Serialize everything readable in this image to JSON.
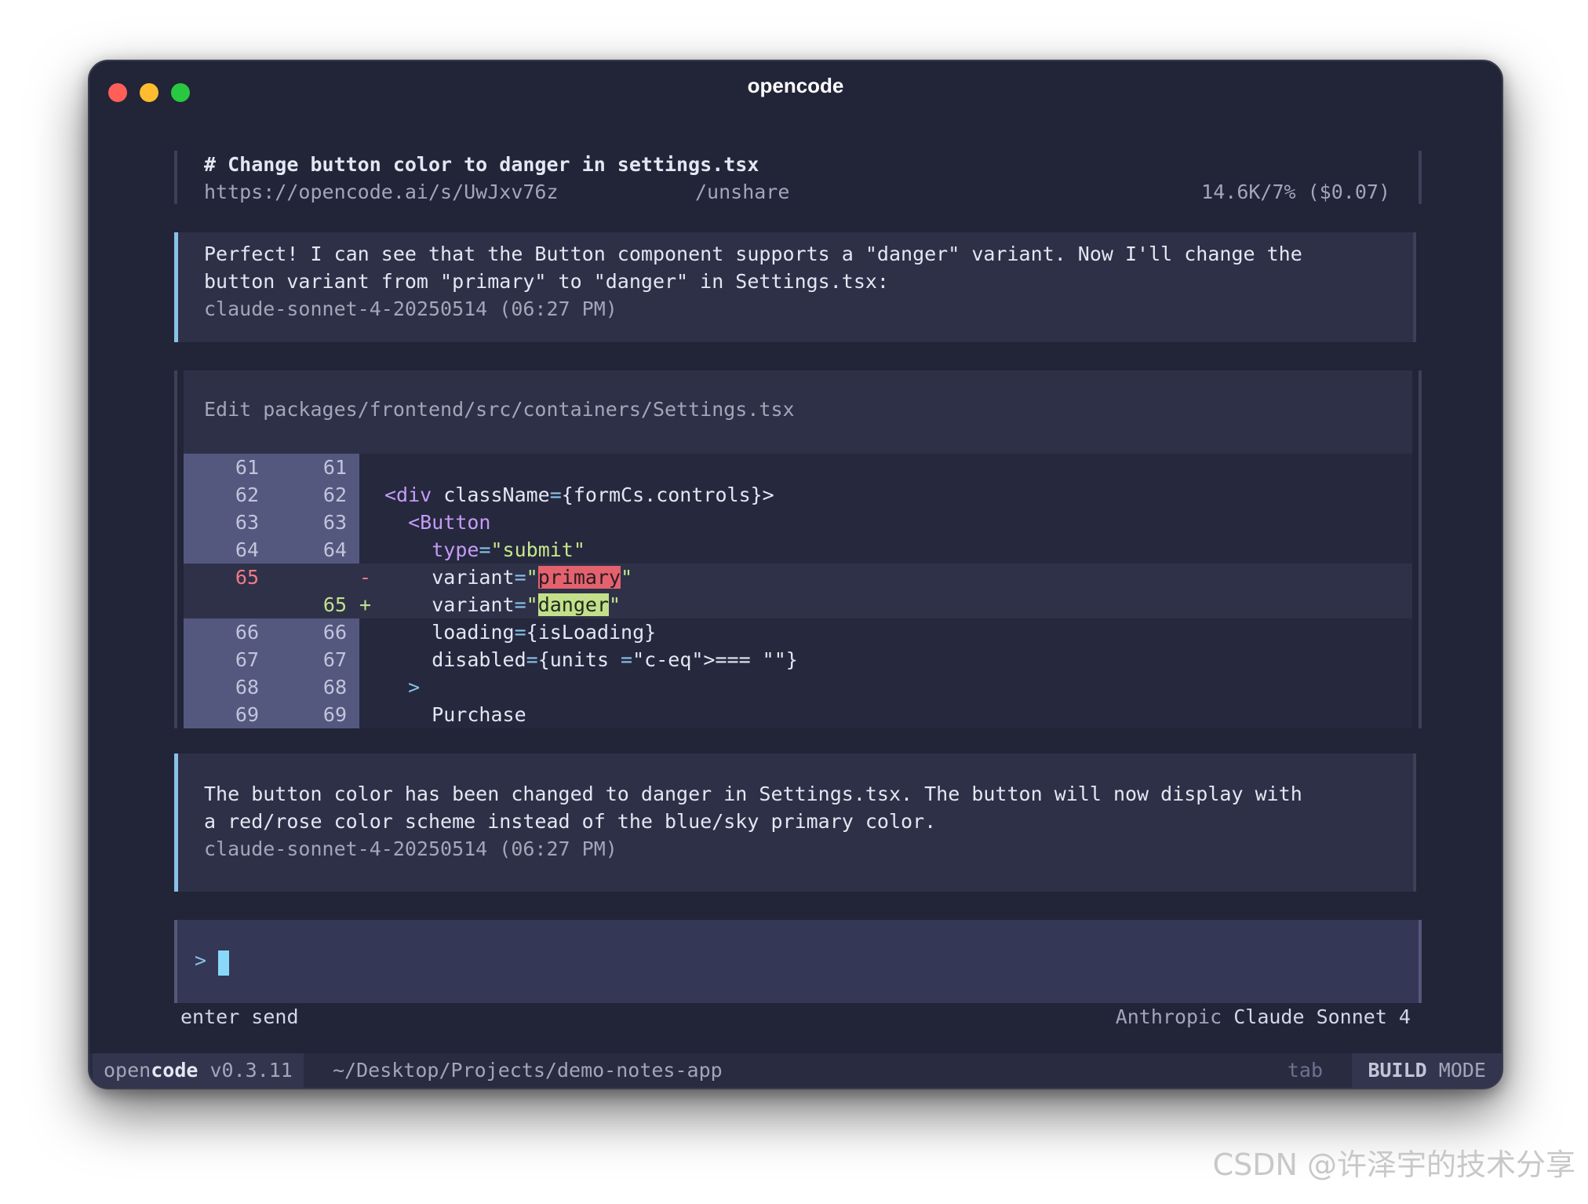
{
  "window": {
    "title": "opencode"
  },
  "header": {
    "title": "# Change button color to danger in settings.tsx",
    "share_link": "https://opencode.ai/s/UwJxv76z",
    "unshare": "/unshare",
    "usage": "14.6K/7% ($0.07)"
  },
  "messages": [
    {
      "lines": [
        "Perfect! I can see that the Button component supports a \"danger\" variant. Now I'll change the",
        "button variant from \"primary\" to \"danger\" in Settings.tsx:"
      ],
      "meta": "claude-sonnet-4-20250514 (06:27 PM)"
    },
    {
      "lines": [
        "The button color has been changed to danger in Settings.tsx. The button will now display with",
        "a red/rose color scheme instead of the blue/sky primary color."
      ],
      "meta": "claude-sonnet-4-20250514 (06:27 PM)"
    }
  ],
  "tool": {
    "header": "Edit packages/frontend/src/containers/Settings.tsx",
    "diff": [
      {
        "old": "61",
        "new": "61",
        "type": "context",
        "code": ""
      },
      {
        "old": "62",
        "new": "62",
        "type": "context",
        "code": "<div className={formCs.controls}>"
      },
      {
        "old": "63",
        "new": "63",
        "type": "context",
        "code": "  <Button"
      },
      {
        "old": "64",
        "new": "64",
        "type": "context",
        "code": "    type=\"submit\""
      },
      {
        "old": "65",
        "new": "",
        "type": "removed",
        "sign": "-",
        "code": "    variant=\"primary\""
      },
      {
        "old": "",
        "new": "65",
        "type": "added",
        "sign": "+",
        "code": "    variant=\"danger\""
      },
      {
        "old": "66",
        "new": "66",
        "type": "context",
        "code": "    loading={isLoading}"
      },
      {
        "old": "67",
        "new": "67",
        "type": "context",
        "code": "    disabled={units === \"\"}"
      },
      {
        "old": "68",
        "new": "68",
        "type": "context",
        "code": "  >"
      },
      {
        "old": "69",
        "new": "69",
        "type": "context",
        "code": "    Purchase"
      }
    ]
  },
  "input": {
    "prompt": ">",
    "value": ""
  },
  "hints": {
    "left": "enter send",
    "provider": "Anthropic",
    "model": "Claude Sonnet 4"
  },
  "statusbar": {
    "app_prefix": "open",
    "app_bold": "code",
    "version": "v0.3.11",
    "path": "~/Desktop/Projects/demo-notes-app",
    "tab": "tab",
    "mode_bold": "BUILD",
    "mode": "MODE"
  },
  "watermark": "CSDN @许泽宇的技术分享",
  "colors": {
    "background": "#222438",
    "panel": "#2e3048",
    "accent": "#89c2e6",
    "removed": "#e4626e",
    "added": "#c2e08a"
  }
}
